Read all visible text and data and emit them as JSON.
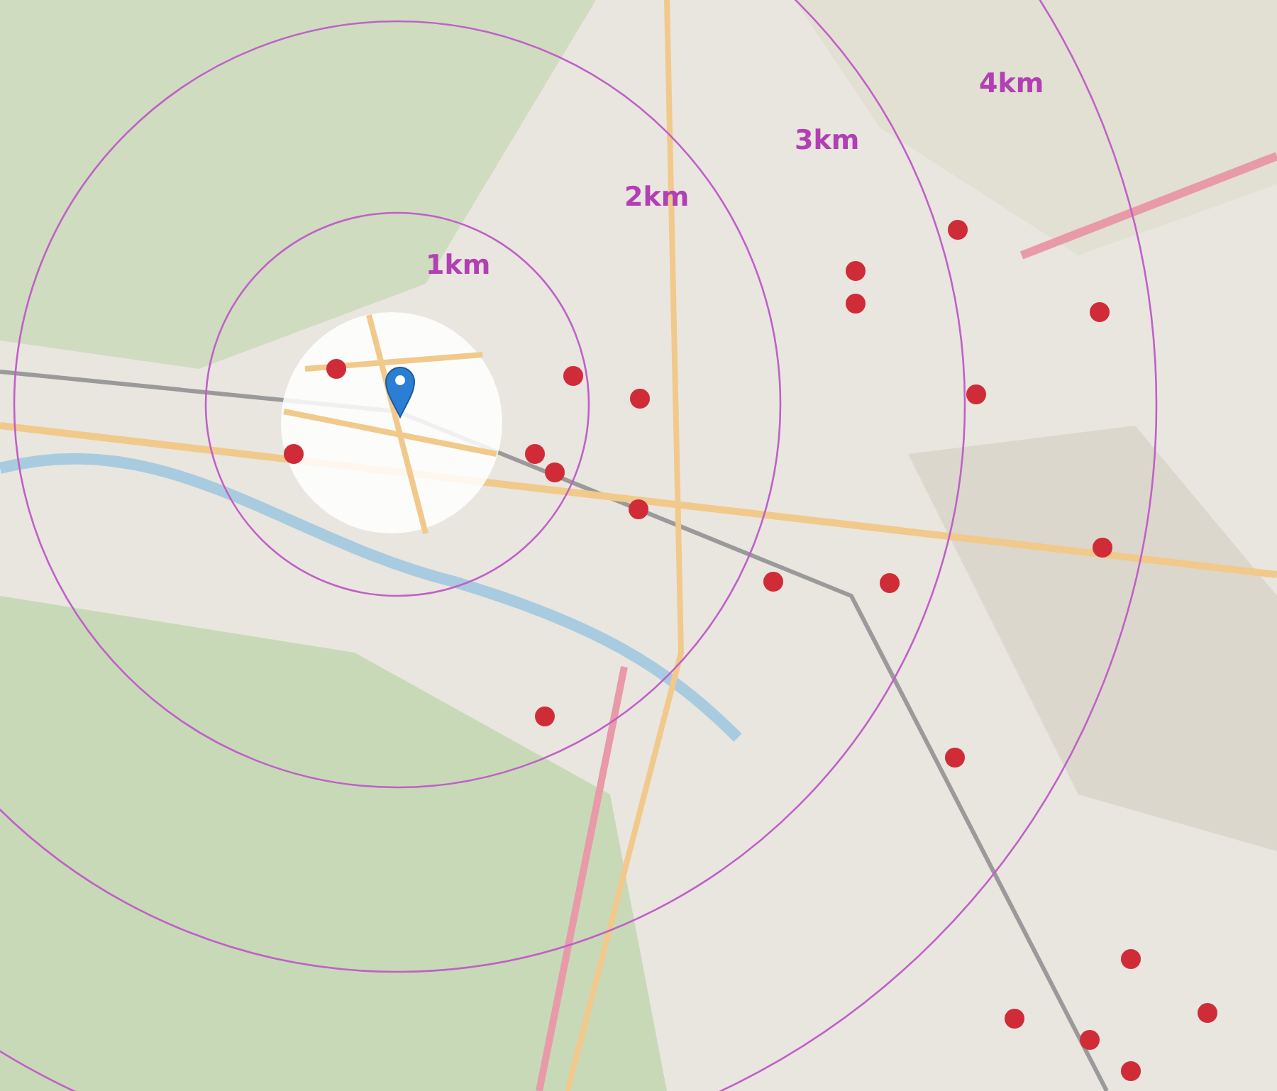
{
  "rings": [
    {
      "label": "1km"
    },
    {
      "label": "2km"
    },
    {
      "label": "3km"
    },
    {
      "label": "4km"
    }
  ]
}
